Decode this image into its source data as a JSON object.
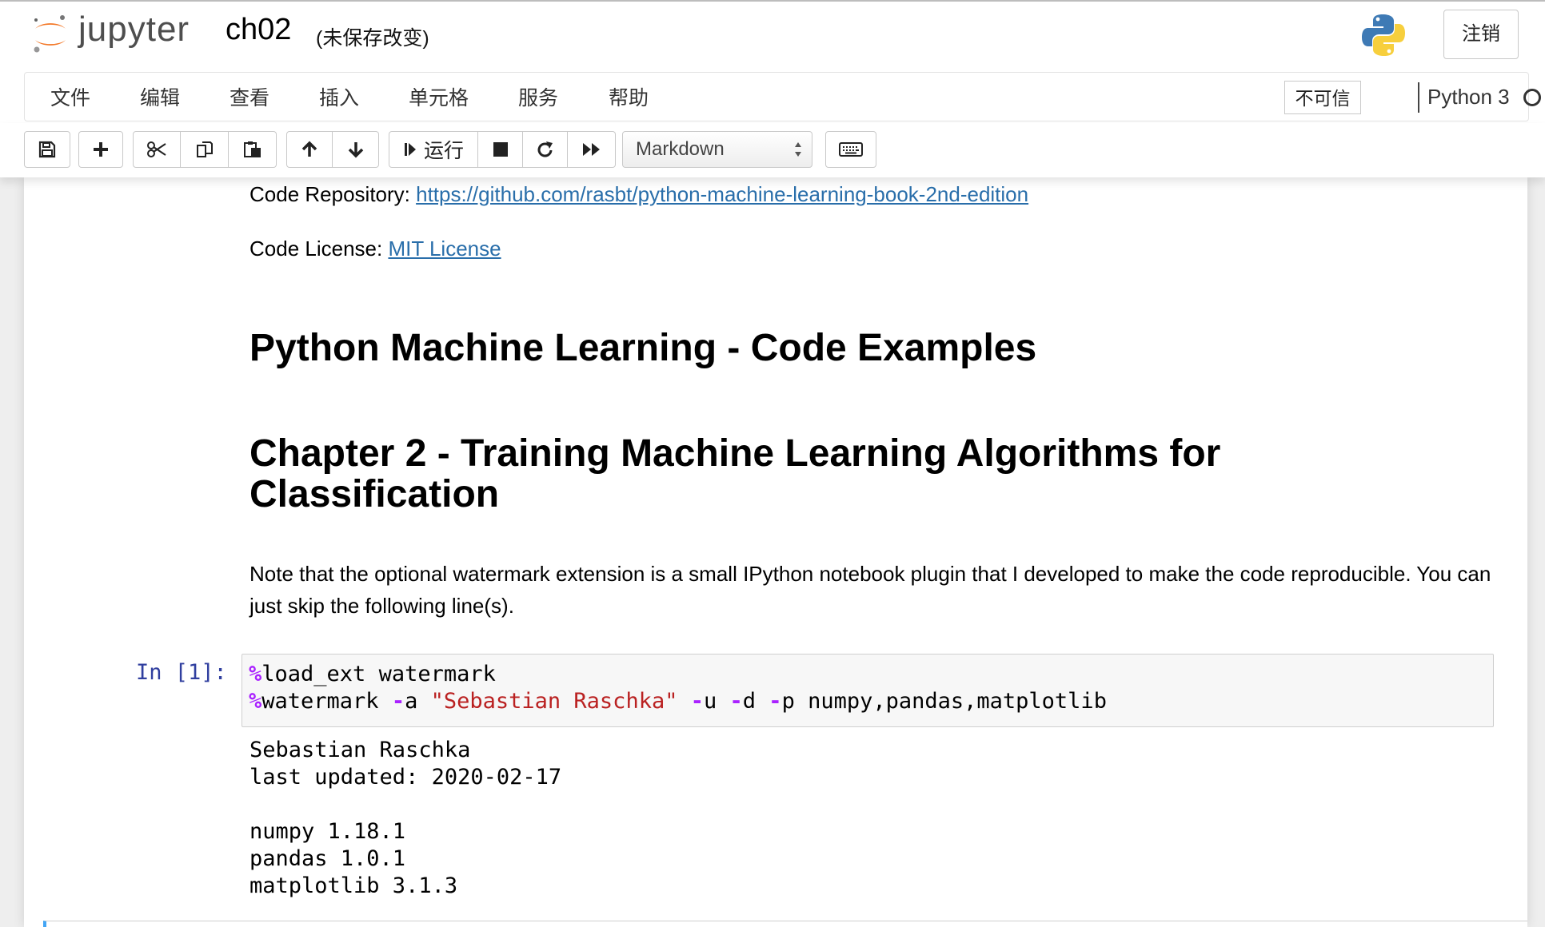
{
  "header": {
    "logo_text": "jupyter",
    "notebook_name": "ch02",
    "save_status": "(未保存改变)",
    "logout_label": "注销"
  },
  "menubar": {
    "items": [
      "文件",
      "编辑",
      "查看",
      "插入",
      "单元格",
      "服务",
      "帮助"
    ],
    "trust_label": "不可信",
    "kernel_name": "Python 3"
  },
  "toolbar": {
    "run_label": "运行",
    "cell_type": "Markdown"
  },
  "notebook": {
    "repo_label": "Code Repository: ",
    "repo_link": "https://github.com/rasbt/python-machine-learning-book-2nd-edition",
    "license_label": "Code License: ",
    "license_link": "MIT License",
    "heading1": "Python Machine Learning - Code Examples",
    "heading2": "Chapter 2 - Training Machine Learning Algorithms for Classification",
    "note": "Note that the optional watermark extension is a small IPython notebook plugin that I developed to make the code reproducible. You can just skip the following line(s).",
    "cell": {
      "prompt": "In [1]:",
      "line1": {
        "magic": "%",
        "text": "load_ext watermark"
      },
      "line2": {
        "magic": "%",
        "cmd": "watermark ",
        "flag_a": "-",
        "a": "a ",
        "author": "\"Sebastian Raschka\"",
        "sp": " ",
        "flag_u": "-",
        "u": "u ",
        "flag_d": "-",
        "d": "d ",
        "flag_p": "-",
        "p": "p numpy,pandas,matplotlib"
      }
    },
    "output": "Sebastian Raschka\nlast updated: 2020-02-17\n\nnumpy 1.18.1\npandas 1.0.1\nmatplotlib 3.1.3"
  }
}
